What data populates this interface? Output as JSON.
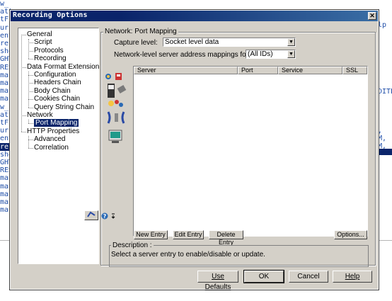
{
  "window": {
    "title": "Recording Options",
    "close_glyph": "✕"
  },
  "background": {
    "left_lines": [
      "w_",
      "att",
      "tF",
      "urc",
      "ent",
      "rer",
      "sho",
      "GHT",
      "RES",
      "ma",
      "ma",
      "ma",
      "ma",
      "",
      "w_",
      "att",
      "tF",
      "urc",
      "ent",
      "rer",
      "sho",
      "GHT",
      "RES",
      "ma",
      "ma",
      "ma",
      "ma",
      "ma"
    ],
    "right_top_text": "elp",
    "right_lines": [
      "DITE",
      "",
      "",
      "",
      "",
      ",",
      "M,",
      "M,"
    ]
  },
  "tree": {
    "items": [
      {
        "label": "General",
        "level": 0
      },
      {
        "label": "Script",
        "level": 1
      },
      {
        "label": "Protocols",
        "level": 1
      },
      {
        "label": "Recording",
        "level": 1
      },
      {
        "label": "Data Format Extension",
        "level": 0
      },
      {
        "label": "Configuration",
        "level": 1
      },
      {
        "label": "Headers Chain",
        "level": 1
      },
      {
        "label": "Body Chain",
        "level": 1
      },
      {
        "label": "Cookies Chain",
        "level": 1
      },
      {
        "label": "Query String Chain",
        "level": 1
      },
      {
        "label": "Network",
        "level": 0
      },
      {
        "label": "Port Mapping",
        "level": 1,
        "selected": true
      },
      {
        "label": "HTTP Properties",
        "level": 0
      },
      {
        "label": "Advanced",
        "level": 1
      },
      {
        "label": "Correlation",
        "level": 1
      }
    ]
  },
  "panel": {
    "group_title": "Network: Port Mapping",
    "capture_level_label": "Capture level:",
    "capture_level_value": "Socket level data",
    "mappings_for_label": "Network-level server address mappings for :",
    "mappings_for_value": "(All IDs)",
    "table_columns": [
      "Server",
      "Port",
      "Service",
      "SSL"
    ],
    "buttons": {
      "new_entry": "New Entry",
      "edit_entry": "Edit Entry",
      "delete_entry": "Delete Entry",
      "options": "Options..."
    },
    "description_title": "Description :",
    "description_text": "Select a server entry to enable/disable or update."
  },
  "footer": {
    "use_defaults": "Use Defaults",
    "ok": "OK",
    "cancel": "Cancel",
    "help": "Help"
  },
  "colors": {
    "dialog_bg": "#d4d0c8",
    "title_bar": "#0a246a",
    "selection": "#0a246a"
  }
}
